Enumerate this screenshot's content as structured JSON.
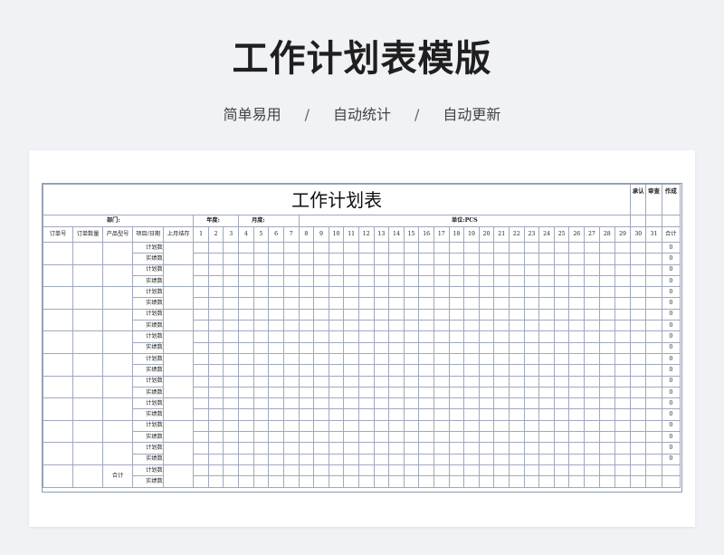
{
  "page": {
    "title": "工作计划表模版",
    "tagline": [
      "简单易用",
      "自动统计",
      "自动更新"
    ],
    "separator": "/"
  },
  "sheet": {
    "title": "工作计划表",
    "approvals": [
      "承认",
      "审查",
      "作成"
    ],
    "info": {
      "department": "部门:",
      "year": "年度:",
      "month": "月度:",
      "unit": "单位:PCS"
    },
    "headers": {
      "order_no": "订单号",
      "order_qty": "订单数量",
      "product_model": "产品型号",
      "item_date": "项目/日期",
      "last_month_stock": "上月结存",
      "days": [
        "1",
        "2",
        "3",
        "4",
        "5",
        "6",
        "7",
        "8",
        "9",
        "10",
        "11",
        "12",
        "13",
        "14",
        "15",
        "16",
        "17",
        "18",
        "19",
        "20",
        "21",
        "22",
        "23",
        "24",
        "25",
        "26",
        "27",
        "28",
        "29",
        "30",
        "31"
      ],
      "total": "合计"
    },
    "row_labels": {
      "plan": "计划数",
      "actual": "实绩数",
      "sum": "合计"
    },
    "group_count": 11,
    "total_values": [
      "0",
      "0",
      "0",
      "0",
      "0",
      "0",
      "0",
      "0",
      "0",
      "0",
      "0",
      "0",
      "0",
      "0",
      "0",
      "0",
      "0",
      "0",
      "0",
      "0"
    ]
  }
}
